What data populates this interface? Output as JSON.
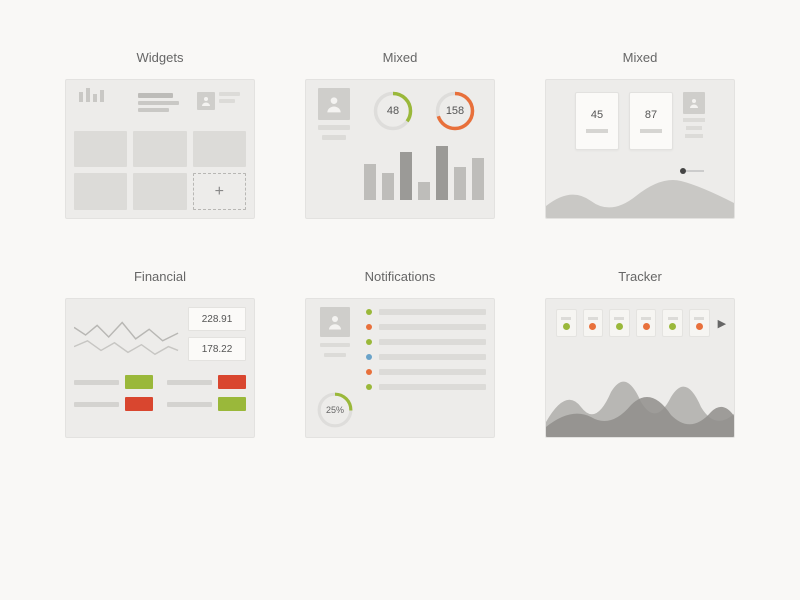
{
  "titles": {
    "widgets": "Widgets",
    "mixed1": "Mixed",
    "mixed2": "Mixed",
    "financial": "Financial",
    "notifications": "Notifications",
    "tracker": "Tracker"
  },
  "mixed1": {
    "gauge_a": "48",
    "gauge_b": "158"
  },
  "mixed2": {
    "card_a": "45",
    "card_b": "87"
  },
  "financial": {
    "value_a": "228.91",
    "value_b": "178.22"
  },
  "notifications": {
    "gauge": "25%"
  },
  "add_glyph": "+",
  "arrow_glyph": "▶",
  "chart_data": {
    "mixed1_bars": [
      60,
      45,
      80,
      30,
      90,
      55,
      70
    ],
    "mixed1_gauges": [
      {
        "value": 48,
        "pct": 35,
        "color": "#9ab83a"
      },
      {
        "value": 158,
        "pct": 70,
        "color": "#e8703b"
      }
    ],
    "notifications_gauge": {
      "pct": 25,
      "color": "#9ab83a"
    },
    "tracker_dots": [
      "green",
      "orange",
      "green",
      "orange",
      "green",
      "orange"
    ]
  }
}
